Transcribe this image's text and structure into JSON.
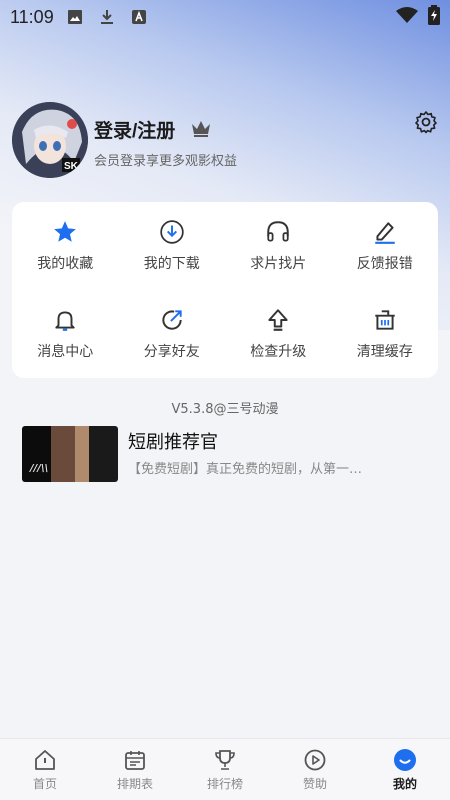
{
  "status_bar": {
    "time": "11:09",
    "icons": [
      "image-icon",
      "download-icon",
      "app-a-icon",
      "wifi-icon",
      "battery-icon"
    ]
  },
  "profile": {
    "username": "登录/注册",
    "subtitle": "会员登录享更多观影权益"
  },
  "menu": {
    "items": [
      {
        "label": "我的收藏",
        "icon": "star-icon"
      },
      {
        "label": "我的下载",
        "icon": "download-circle-icon"
      },
      {
        "label": "求片找片",
        "icon": "headphones-icon"
      },
      {
        "label": "反馈报错",
        "icon": "edit-icon"
      },
      {
        "label": "消息中心",
        "icon": "bell-icon"
      },
      {
        "label": "分享好友",
        "icon": "share-icon"
      },
      {
        "label": "检查升级",
        "icon": "upgrade-icon"
      },
      {
        "label": "清理缓存",
        "icon": "clean-icon"
      }
    ]
  },
  "version": "V5.3.8@三号动漫",
  "promo": {
    "title": "短剧推荐官",
    "description": "【免费短剧】真正免费的短剧，从第一…"
  },
  "tabbar": {
    "tabs": [
      {
        "label": "首页",
        "icon": "home-icon"
      },
      {
        "label": "排期表",
        "icon": "calendar-icon"
      },
      {
        "label": "排行榜",
        "icon": "trophy-icon"
      },
      {
        "label": "赞助",
        "icon": "play-circle-icon"
      },
      {
        "label": "我的",
        "icon": "profile-smile-icon",
        "active": true
      }
    ]
  },
  "colors": {
    "accent": "#1e6ff0",
    "tab_active": "#1e6ff0",
    "icon": "#333333"
  }
}
